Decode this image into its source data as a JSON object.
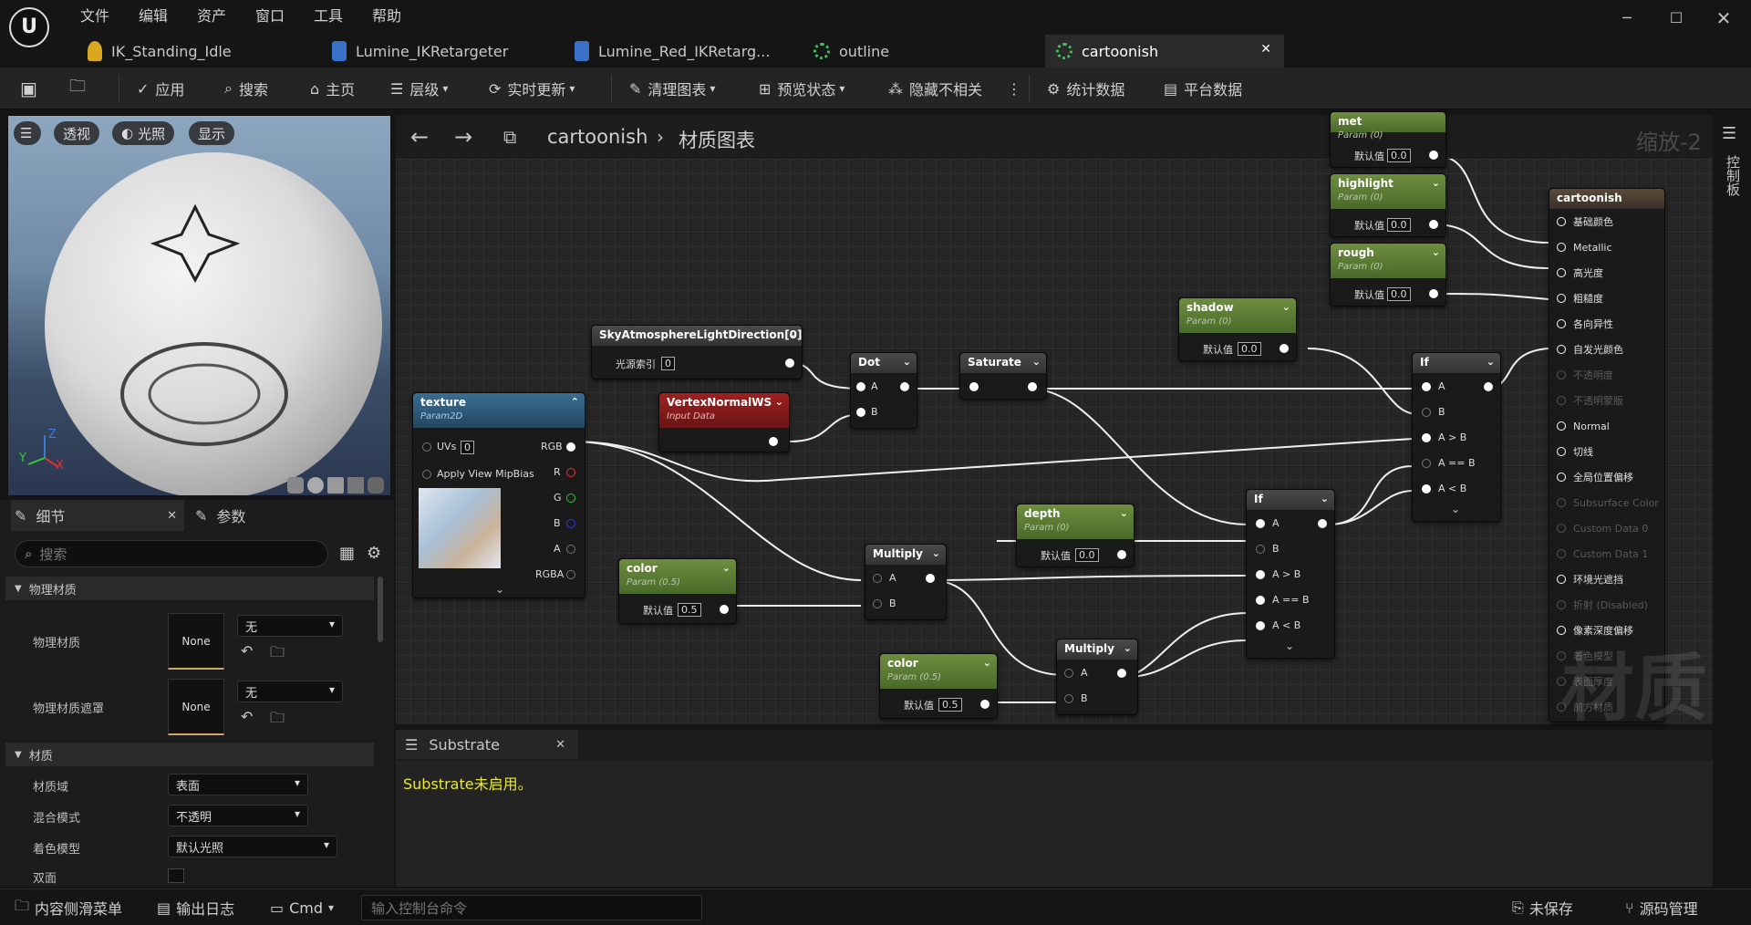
{
  "menu": [
    "文件",
    "编辑",
    "资产",
    "窗口",
    "工具",
    "帮助"
  ],
  "tabs": [
    {
      "label": "IK_Standing_Idle",
      "icon": "person-icon"
    },
    {
      "label": "Lumine_IKRetargeter",
      "icon": "retarget-icon"
    },
    {
      "label": "Lumine_Red_IKRetarg...",
      "icon": "retarget-icon"
    },
    {
      "label": "outline",
      "icon": "material-icon"
    },
    {
      "label": "cartoonish",
      "icon": "material-icon"
    }
  ],
  "toolbar": {
    "apply": "应用",
    "search": "搜索",
    "home": "主页",
    "hierarchy": "层级",
    "live_update": "实时更新",
    "clean_graph": "清理图表",
    "preview_state": "预览状态",
    "hide_unrelated": "隐藏不相关",
    "stats": "统计数据",
    "platform_stats": "平台数据"
  },
  "viewport": {
    "perspective": "透视",
    "lit": "光照",
    "show": "显示",
    "axis_x": "X",
    "axis_z": "Z",
    "axis_y": "Y"
  },
  "details": {
    "tab_details": "细节",
    "tab_params": "参数",
    "search_placeholder": "搜索",
    "sec_physical": "物理材质",
    "phys_mat": "物理材质",
    "phys_mat_none": "None",
    "phys_mat_dd": "无",
    "phys_mask": "物理材质遮罩",
    "phys_mask_none": "None",
    "phys_mask_dd": "无",
    "sec_material": "材质",
    "domain": "材质域",
    "domain_val": "表面",
    "blend": "混合模式",
    "blend_val": "不透明",
    "shading": "着色模型",
    "shading_val": "默认光照",
    "two_sided": "双面"
  },
  "graph": {
    "title": "cartoonish",
    "breadcrumb": "材质图表",
    "zoom": "缩放-2",
    "watermark": "材质",
    "side_label": "控制板"
  },
  "nodes": {
    "met": {
      "title": "met",
      "sub": "Param (0)",
      "label": "默认值",
      "value": "0.0"
    },
    "highlight": {
      "title": "highlight",
      "sub": "Param (0)",
      "label": "默认值",
      "value": "0.0"
    },
    "rough": {
      "title": "rough",
      "sub": "Param (0)",
      "label": "默认值",
      "value": "0.0"
    },
    "shadow": {
      "title": "shadow",
      "sub": "Param (0)",
      "label": "默认值",
      "value": "0.0"
    },
    "sky": {
      "title": "SkyAtmosphereLightDirection[0]",
      "label": "光源索引",
      "value": "0"
    },
    "dot": {
      "title": "Dot",
      "a": "A",
      "b": "B"
    },
    "saturate": {
      "title": "Saturate"
    },
    "texture": {
      "title": "texture",
      "sub": "Param2D",
      "uvs": "UVs",
      "uvs_val": "0",
      "mip": "Apply View MipBias",
      "rgb": "RGB",
      "r": "R",
      "g": "G",
      "b": "B",
      "a": "A",
      "rgba": "RGBA"
    },
    "vnormal": {
      "title": "VertexNormalWS",
      "sub": "Input Data"
    },
    "color1": {
      "title": "color",
      "sub": "Param (0.5)",
      "label": "默认值",
      "value": "0.5"
    },
    "multiply1": {
      "title": "Multiply",
      "a": "A",
      "b": "B"
    },
    "depth": {
      "title": "depth",
      "sub": "Param (0)",
      "label": "默认值",
      "value": "0.0"
    },
    "color2": {
      "title": "color",
      "sub": "Param (0.5)",
      "label": "默认值",
      "value": "0.5"
    },
    "multiply2": {
      "title": "Multiply",
      "a": "A",
      "b": "B"
    },
    "if1": {
      "title": "If",
      "pins": [
        "A",
        "B",
        "A > B",
        "A == B",
        "A < B"
      ]
    },
    "if2": {
      "title": "If",
      "pins": [
        "A",
        "B",
        "A > B",
        "A == B",
        "A < B"
      ]
    },
    "result": {
      "title": "cartoonish",
      "pins": [
        "基础颜色",
        "Metallic",
        "高光度",
        "粗糙度",
        "各向异性",
        "自发光颜色",
        "不透明度",
        "不透明蒙版",
        "Normal",
        "切线",
        "全局位置偏移",
        "Subsurface Color",
        "Custom Data 0",
        "Custom Data 1",
        "环境光遮挡",
        "折射 (Disabled)",
        "像素深度偏移",
        "着色模型",
        "表面厚度",
        "前方材质"
      ]
    }
  },
  "substrate": {
    "tab": "Substrate",
    "message": "Substrate未启用。"
  },
  "status": {
    "content_drawer": "内容侧滑菜单",
    "output_log": "输出日志",
    "cmd": "Cmd",
    "cmd_placeholder": "输入控制台命令",
    "save_label": "未保存",
    "source_control": "源码管理"
  }
}
